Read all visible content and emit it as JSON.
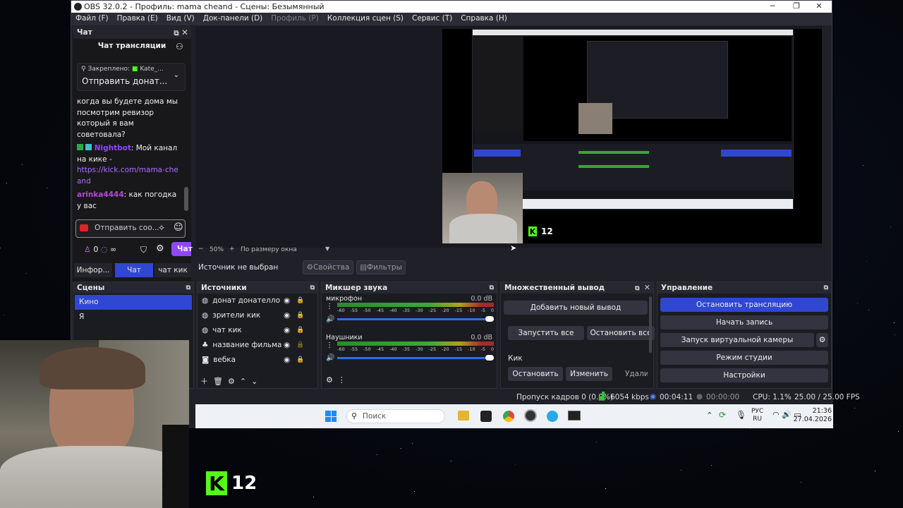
{
  "window": {
    "title": "OBS 32.0.2 - Профиль: mama cheand - Сцены: Безымянный",
    "controls": [
      "─",
      "❐",
      "✕"
    ]
  },
  "menu": [
    {
      "label": "Файл (F)",
      "disabled": false
    },
    {
      "label": "Правка (E)",
      "disabled": false
    },
    {
      "label": "Вид (V)",
      "disabled": false
    },
    {
      "label": "Док-панели (D)",
      "disabled": false
    },
    {
      "label": "Профиль (P)",
      "disabled": true
    },
    {
      "label": "Коллекция сцен (S)",
      "disabled": false
    },
    {
      "label": "Сервис (T)",
      "disabled": false
    },
    {
      "label": "Справка (H)",
      "disabled": false
    }
  ],
  "chat": {
    "dock_title": "Чат",
    "header": "Чат трансляции",
    "pinned_label": "Закреплено:",
    "pinned_user": "Kate_...",
    "pinned_text": "Отправить донат...",
    "messages": [
      {
        "user": "",
        "text": "когда вы будете дома мы посмотрим ревизор который я вам советовала?"
      },
      {
        "user": "Nightbot",
        "text": ": Мой канал на кике -",
        "link": "https://kick.com/mama-cheand"
      },
      {
        "user": "arinka4444",
        "text": ": как погодка у вас"
      }
    ],
    "input_placeholder": "Отправить соо...",
    "points": "0",
    "infinity": "∞",
    "send_label": "Чат",
    "tabs": [
      "Инфор...",
      "Чат",
      "чат кик"
    ],
    "active_tab": 1
  },
  "preview": {
    "zoom": "50%",
    "fit_label": "По размеру окна",
    "kick_count": "12"
  },
  "source_bar": {
    "no_source": "Источник не выбран",
    "properties": "Свойства",
    "filters": "Фильтры"
  },
  "scenes": {
    "title": "Сцены",
    "items": [
      "Кино",
      "Я"
    ],
    "selected": 0
  },
  "sources": {
    "title": "Источники",
    "items": [
      {
        "name": "донат донателло",
        "locked": true
      },
      {
        "name": "зрители кик",
        "locked": true
      },
      {
        "name": "чат кик",
        "locked": true
      },
      {
        "name": "название фильма",
        "locked": false
      },
      {
        "name": "вебка",
        "locked": true
      }
    ]
  },
  "mixer": {
    "title": "Микшер звука",
    "channels": [
      {
        "name": "микрофон",
        "db": "0.0 dB",
        "volume": 1.0
      },
      {
        "name": "Наушники",
        "db": "0.0 dB",
        "volume": 1.0
      }
    ],
    "scale": [
      "-60",
      "-55",
      "-50",
      "-45",
      "-40",
      "-35",
      "-30",
      "-25",
      "-20",
      "-15",
      "-10",
      "-5",
      "0"
    ]
  },
  "multi_output": {
    "title": "Множественный вывод",
    "add_label": "Добавить новый вывод",
    "start_all": "Запустить все",
    "stop_all": "Остановить все",
    "target_name": "Кик",
    "stop": "Остановить",
    "edit": "Изменить",
    "delete": "Удалит"
  },
  "controls": {
    "title": "Управление",
    "buttons": [
      "Остановить трансляцию",
      "Начать запись",
      "Запуск виртуальной камеры",
      "Режим студии",
      "Настройки"
    ]
  },
  "status": {
    "dropped": "Пропуск кадров 0 (0.0%)",
    "bitrate": "6054 kbps",
    "stream_time": "00:04:11",
    "rec_time": "00:00:00",
    "cpu": "CPU: 1.1%",
    "fps": "25.00 / 25.00 FPS"
  },
  "taskbar": {
    "search_placeholder": "Поиск",
    "lang_top": "РУС",
    "lang_bottom": "RU",
    "time": "21:36",
    "date": "27.04.2026"
  },
  "overlay": {
    "kick_count": "12"
  },
  "colors": {
    "accent": "#2f47d1",
    "kick_green": "#53fc18",
    "twitch_purple": "#9147ff"
  }
}
